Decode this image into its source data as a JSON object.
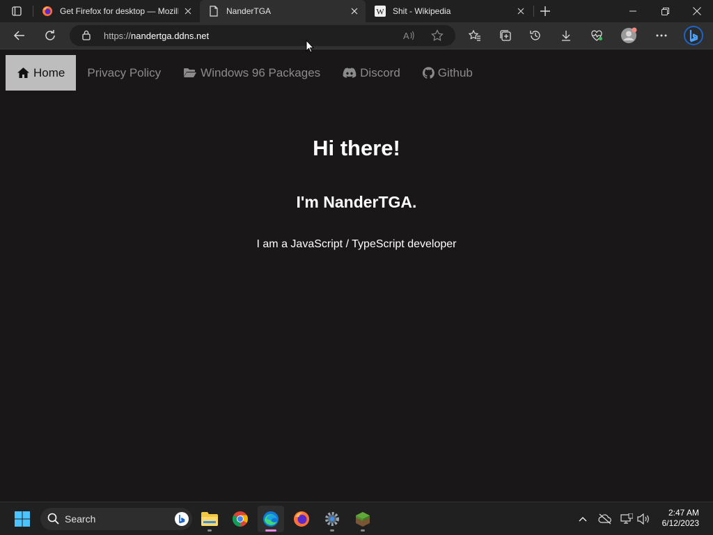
{
  "browser": {
    "tabs": [
      {
        "title": "Get Firefox for desktop — Mozill",
        "icon": "firefox-icon",
        "active": false
      },
      {
        "title": "NanderTGA",
        "icon": "page-icon",
        "active": true
      },
      {
        "title": "Shit - Wikipedia",
        "icon": "wikipedia-icon",
        "active": false
      }
    ],
    "url_scheme": "https://",
    "url_host": "nandertga.ddns.net"
  },
  "site": {
    "nav": [
      {
        "label": "Home",
        "icon": "home-icon",
        "active": true
      },
      {
        "label": "Privacy Policy",
        "icon": "",
        "active": false
      },
      {
        "label": "Windows 96 Packages",
        "icon": "folder-open-icon",
        "active": false
      },
      {
        "label": "Discord",
        "icon": "discord-icon",
        "active": false
      },
      {
        "label": "Github",
        "icon": "github-icon",
        "active": false
      }
    ],
    "heading": "Hi there!",
    "subheading": "I'm NanderTGA.",
    "intro": "I am a JavaScript / TypeScript developer"
  },
  "taskbar": {
    "search_label": "Search",
    "time": "2:47 AM",
    "date": "6/12/2023"
  },
  "colors": {
    "page_bg": "#1a1718",
    "nav_active_bg": "#bdbdbd",
    "nav_text": "#8b8b8b"
  }
}
